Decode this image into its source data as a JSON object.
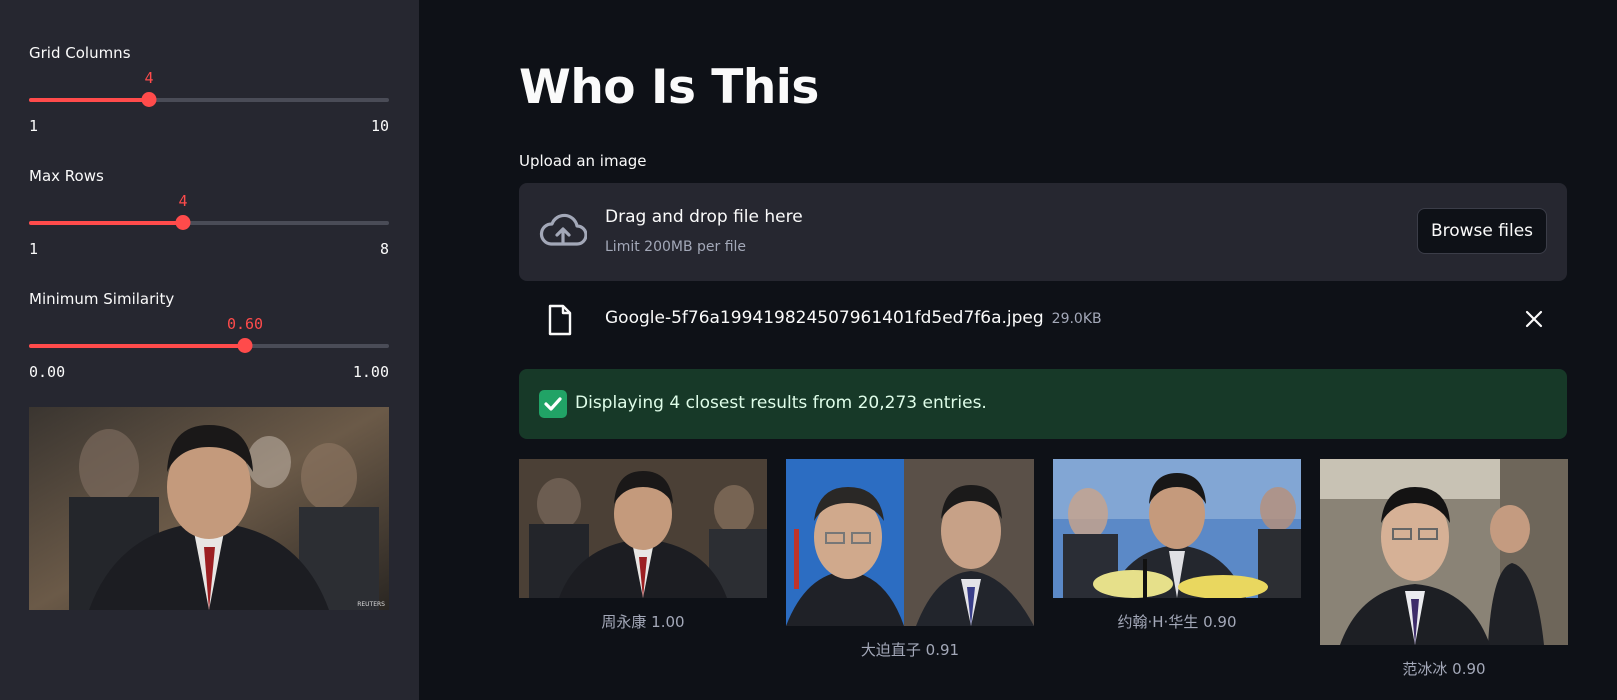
{
  "sidebar": {
    "sliders": [
      {
        "label": "Grid Columns",
        "value": "4",
        "min": "1",
        "max": "10",
        "fraction": 0.333
      },
      {
        "label": "Max Rows",
        "value": "4",
        "min": "1",
        "max": "8",
        "fraction": 0.428
      },
      {
        "label": "Minimum Similarity",
        "value": "0.60",
        "min": "0.00",
        "max": "1.00",
        "fraction": 0.6
      }
    ],
    "watermark": "REUTERS"
  },
  "main": {
    "title": "Who Is This",
    "upload": {
      "label": "Upload an image",
      "drop_title": "Drag and drop file here",
      "drop_limit": "Limit 200MB per file",
      "browse_label": "Browse files",
      "icon": "cloud-upload-icon"
    },
    "file": {
      "name": "Google-5f76a199419824507961401fd5ed7f6a.jpeg",
      "size": "29.0KB",
      "icon": "file-icon",
      "close_icon": "close-icon"
    },
    "success": {
      "icon": "check-icon",
      "text": "Displaying 4 closest results from 20,273 entries."
    },
    "results": [
      {
        "caption": "周永康 1.00"
      },
      {
        "caption": "大迫直子 0.91"
      },
      {
        "caption": "约翰·H·华生 0.90"
      },
      {
        "caption": "范冰冰 0.90"
      }
    ]
  },
  "colors": {
    "accent": "#ff4b4b",
    "background": "#0e1117",
    "sidebar": "#262730",
    "success_bg": "#173928"
  }
}
